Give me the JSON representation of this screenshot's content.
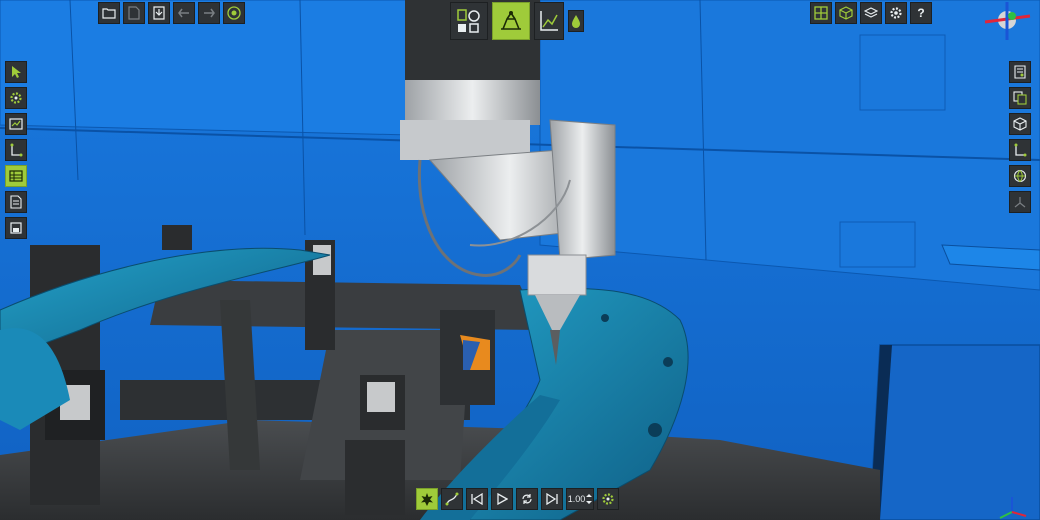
{
  "scene": {
    "background_color": "#1670d6",
    "fixture_color": "#2a2c2e",
    "part_color": "#1a86b8",
    "robot_color": "#d4d6d8"
  },
  "top_left_toolbar": [
    "folder-open-icon",
    "new-file-icon",
    "save-icon",
    "undo-icon",
    "redo-icon",
    "target-icon"
  ],
  "top_center_toolbar": [
    "workcell-setup-icon",
    "simulation-icon",
    "path-graph-icon",
    "paint-drop-icon"
  ],
  "top_right_toolbar": {
    "buttons": [
      "grid-view-icon",
      "cube-view-icon",
      "layers-icon",
      "settings-icon",
      "help-icon"
    ],
    "help_label": "?"
  },
  "left_toolbar": [
    "select-pointer-icon",
    "gear-settings-icon",
    "frame-icon",
    "axis-icon",
    "table-icon",
    "document-icon",
    "save-disk-icon"
  ],
  "right_toolbar": [
    "report-icon",
    "copy-icon",
    "box-icon",
    "axis-icon",
    "globe-icon",
    "triangle-axis-icon"
  ],
  "playback": {
    "buttons": [
      "collision-icon",
      "path-icon",
      "skip-back-icon",
      "play-icon",
      "loop-icon",
      "skip-forward-icon"
    ],
    "speed": "1.00",
    "settings": "gear-settings-icon"
  },
  "accent_color": "#9fcb3a"
}
